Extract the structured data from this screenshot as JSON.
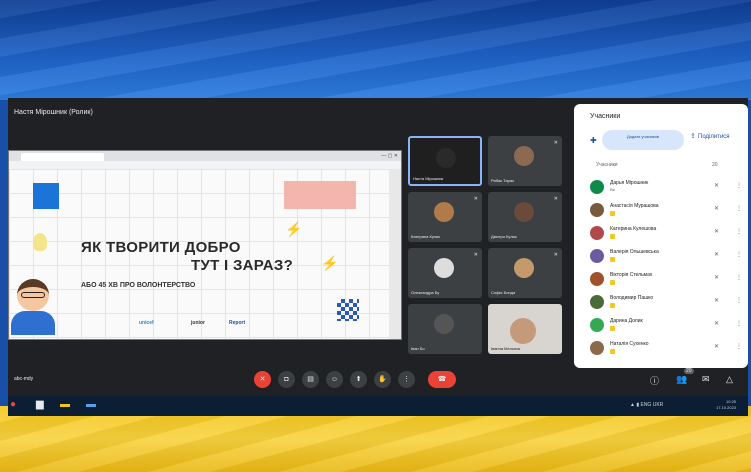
{
  "meet": {
    "presenter_label": "Настя Мірошник (Ролик)",
    "meeting_code": "abc-mdy"
  },
  "slide": {
    "title_line1": "ЯК ТВОРИТИ ДОБРО",
    "title_line2": "ТУТ І ЗАРАЗ?",
    "subtitle": "АБО 45 ХВ ПРО ВОЛОНТЕРСТВО",
    "logos": [
      "unicef",
      "junior",
      "Report"
    ]
  },
  "videos": [
    {
      "name": "Настя Мірошник",
      "active": true
    },
    {
      "name": "Рибак Тарас"
    },
    {
      "name": "Катерина Кулик"
    },
    {
      "name": "Дмитро Кулик"
    },
    {
      "name": "Олександра Бу"
    },
    {
      "name": "Софія Бонда"
    },
    {
      "name": "Іван Бо"
    },
    {
      "name": "Іванна Мельник",
      "camera": true
    }
  ],
  "participants": {
    "title": "Учасники",
    "add_label": "Додати учасників",
    "share_label": "Поділитися",
    "section_label": "Учасники",
    "section_count": "20",
    "list": [
      {
        "name": "Дарья Мірошник",
        "sub": "Ви",
        "color": "#0f8a4a"
      },
      {
        "name": "Анастасія Мурашова",
        "color": "#7a5a3c"
      },
      {
        "name": "Катерина Кулешова",
        "color": "#b04a4a"
      },
      {
        "name": "Валерія Ольшевська",
        "color": "#6a5aa0"
      },
      {
        "name": "Вікторія Стельмах",
        "color": "#a0522d"
      },
      {
        "name": "Володимир Пашко",
        "color": "#4a6a3a"
      },
      {
        "name": "Дарина Долик",
        "color": "#34a853"
      },
      {
        "name": "Наталія Сухенко",
        "color": "#8a6a4a"
      }
    ]
  },
  "controls": {
    "buttons": [
      {
        "name": "mic-off-button",
        "glyph": "✕",
        "red": true
      },
      {
        "name": "camera-button",
        "glyph": "◘"
      },
      {
        "name": "captions-button",
        "glyph": "▤"
      },
      {
        "name": "reactions-button",
        "glyph": "☺"
      },
      {
        "name": "present-button",
        "glyph": "⬆"
      },
      {
        "name": "raise-hand-button",
        "glyph": "✋"
      },
      {
        "name": "more-options-button",
        "glyph": "⋮"
      }
    ],
    "end_glyph": "☎",
    "badge_count": "20"
  },
  "taskbar": {
    "tray_text": "▲ ▮ ENG UKR",
    "time": "10:25",
    "date": "17.10.2023"
  },
  "colors": {
    "flag_blue": "#1e63c7",
    "flag_yellow": "#f4c61a",
    "end_call": "#ea4335",
    "accent": "#8ab4f8"
  }
}
